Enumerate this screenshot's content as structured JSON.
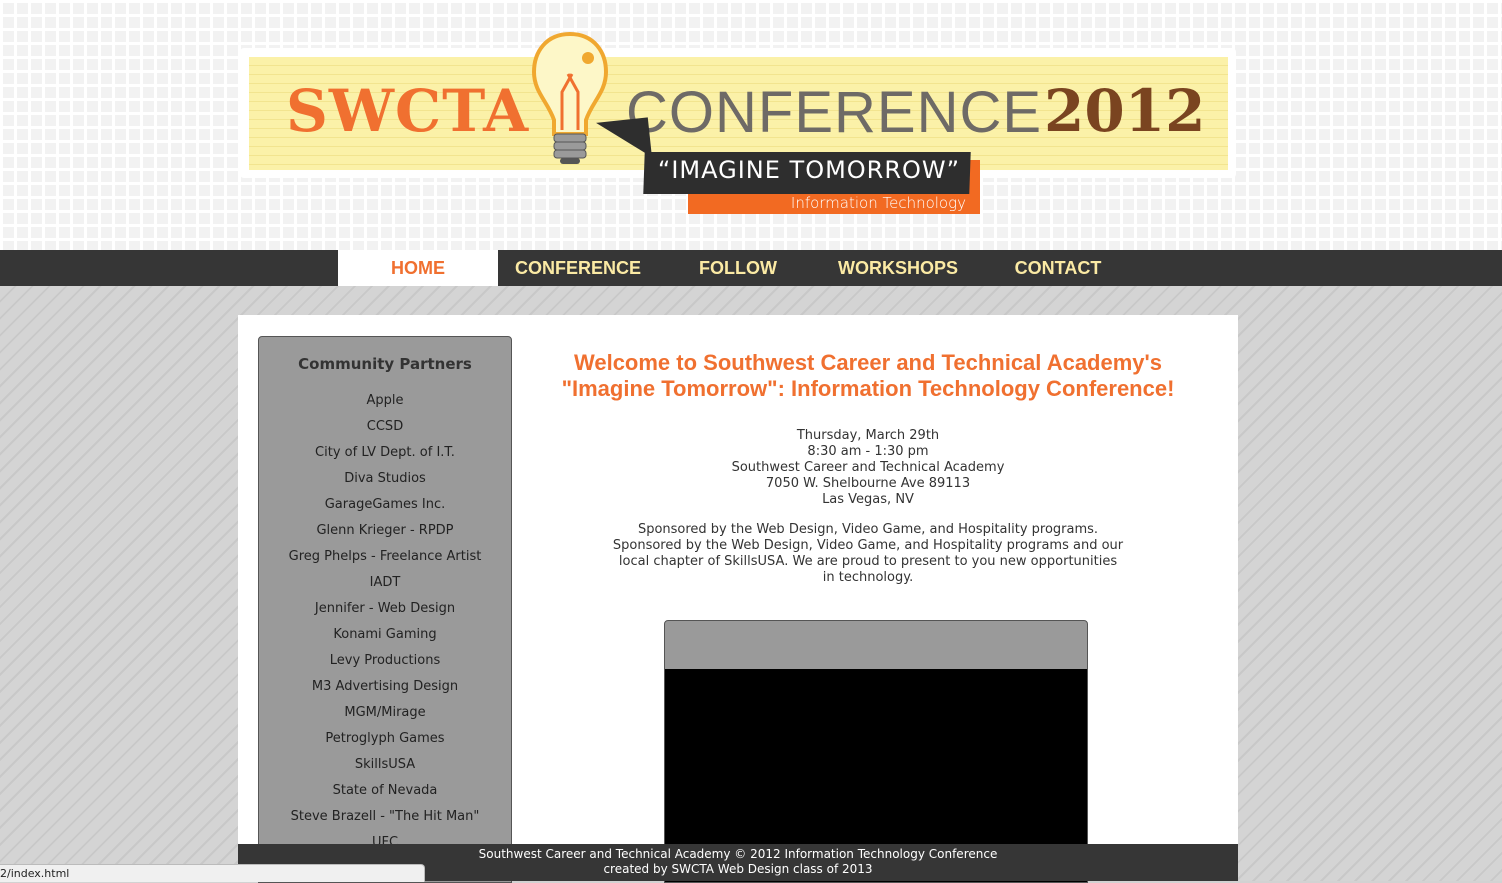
{
  "banner": {
    "logo_left": "SWCTA",
    "logo_mid": "CONFERENCE",
    "logo_year": "2012",
    "tagline": "“IMAGINE TOMORROW”",
    "subtitle": "Information Technology",
    "accent": "#f07030",
    "bulb_icon": "lightbulb-icon"
  },
  "nav": {
    "items": [
      {
        "label": "HOME"
      },
      {
        "label": "CONFERENCE"
      },
      {
        "label": "FOLLOW"
      },
      {
        "label": "WORKSHOPS"
      },
      {
        "label": "CONTACT"
      }
    ],
    "active_color": "#f07030",
    "text_color": "#fbeaa4"
  },
  "sidebar": {
    "title": "Community Partners",
    "partners": [
      "Apple",
      "CCSD",
      "City of LV Dept. of I.T.",
      "Diva Studios",
      "GarageGames Inc.",
      "Glenn Krieger - RPDP",
      "Greg Phelps - Freelance Artist",
      "IADT",
      "Jennifer - Web Design",
      "Konami Gaming",
      "Levy Productions",
      "M3 Advertising Design",
      "MGM/Mirage",
      "Petroglyph Games",
      "SkillsUSA",
      "State of Nevada",
      "Steve Brazell - \"The Hit Man\"",
      "UFC"
    ]
  },
  "main": {
    "welcome_line1": "Welcome to Southwest Career and Technical Academy's",
    "welcome_line2": "\"Imagine Tomorrow\": Information Technology Conference!",
    "date": "Thursday, March 29th",
    "time": "8:30 am - 1:30 pm",
    "venue": "Southwest Career and Technical Academy",
    "street": "7050 W. Shelbourne Ave 89113",
    "city": "Las Vegas, NV",
    "sponsor_short": "Sponsored by the Web Design, Video Game, and Hospitality programs.",
    "sponsor_long": "Sponsored by the Web Design, Video Game, and Hospitality programs and our local chapter of SkillsUSA. We are proud to present to you new opportunities in technology."
  },
  "footer": {
    "line1": "Southwest Career and Technical Academy © 2012 Information Technology Conference",
    "line2": "created by SWCTA Web Design class of 2013"
  },
  "status_bar": {
    "url": "2/index.html"
  }
}
